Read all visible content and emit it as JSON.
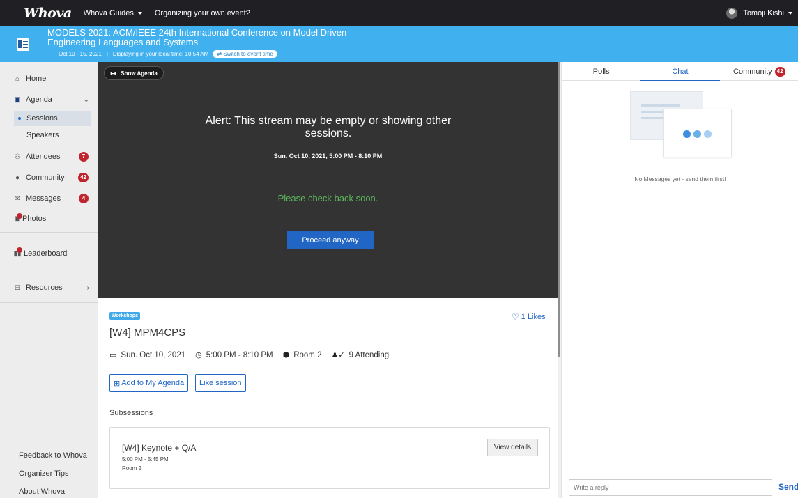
{
  "app": {
    "logo": "Whova"
  },
  "topnav": {
    "guides": "Whova Guides",
    "organizing": "Organizing your own event?",
    "user": "Tomoji Kishi"
  },
  "event": {
    "title": "MODELS 2021: ACM/IEEE 24th International Conference on Model Driven Engineering Languages and Systems",
    "dates": "Oct 10 - 15, 2021",
    "separator": "|",
    "local_time": "Displaying in your local time: 10:54 AM",
    "switch_label": "Switch to event time"
  },
  "sidebar": {
    "home": "Home",
    "agenda": "Agenda",
    "sessions": "Sessions",
    "speakers": "Speakers",
    "attendees": "Attendees",
    "attendees_count": "7",
    "community": "Community",
    "community_count": "42",
    "messages": "Messages",
    "messages_count": "4",
    "photos": "Photos",
    "leaderboard": "Leaderboard",
    "resources": "Resources",
    "feedback": "Feedback to Whova",
    "organizer_tips": "Organizer Tips",
    "about": "About Whova"
  },
  "video": {
    "show_agenda": "Show Agenda",
    "alert": "Alert: This stream may be empty or showing other sessions.",
    "time": "Sun. Oct 10, 2021, 5:00 PM - 8:10 PM",
    "check_back": "Please check back soon.",
    "proceed": "Proceed anyway"
  },
  "session": {
    "tag": "Workshops",
    "likes": "1 Likes",
    "title": "[W4] MPM4CPS",
    "date": "Sun. Oct 10, 2021",
    "time": "5:00 PM - 8:10 PM",
    "room": "Room 2",
    "attending": "9 Attending",
    "add_agenda": "Add to My Agenda",
    "like_session": "Like session",
    "subsessions_label": "Subsessions",
    "subsession": {
      "title": "[W4] Keynote + Q/A",
      "time": "5:00 PM - 5:45 PM",
      "room": "Room 2",
      "view_details": "View details"
    }
  },
  "right_panel": {
    "tabs": {
      "polls": "Polls",
      "chat": "Chat",
      "community": "Community",
      "community_count": "42"
    },
    "active_tab": "Chat",
    "empty_message": "No Messages yet - send them first!",
    "reply_placeholder": "Write a reply",
    "send": "Send"
  },
  "colors": {
    "topbar": "#1f1f24",
    "banner": "#41b0ee",
    "accent": "#2166c4",
    "badge": "#c0252d",
    "video_bg": "#333333",
    "check_back": "#5cb85c"
  }
}
